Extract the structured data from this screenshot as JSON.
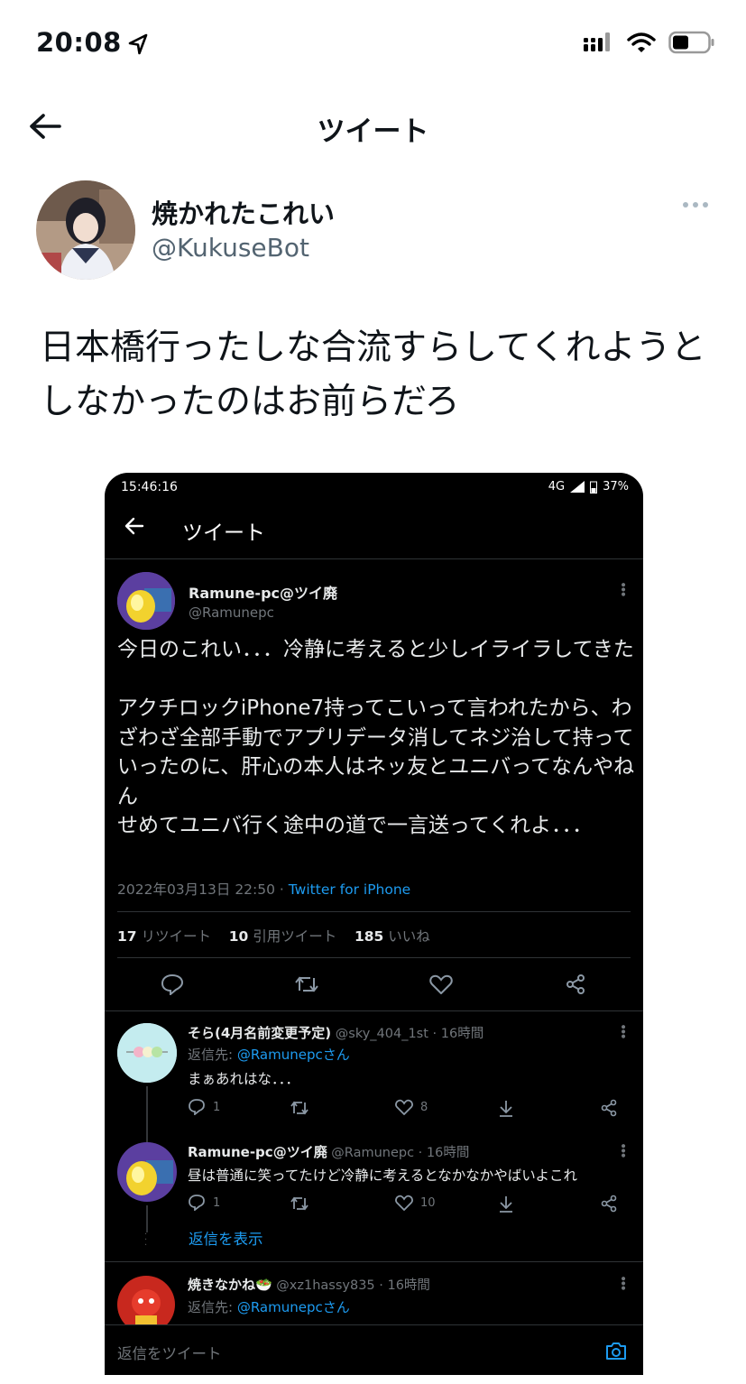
{
  "status_bar": {
    "time": "20:08"
  },
  "header": {
    "title": "ツイート"
  },
  "tweet": {
    "display_name": "焼かれたこれい",
    "handle": "@KukuseBot",
    "text": "日本橋行ったしな合流すらしてくれようとしなかったのはお前らだろ"
  },
  "embedded": {
    "status_time": "15:46:16",
    "status_net": "4G",
    "battery": "37%",
    "header_title": "ツイート",
    "tweet": {
      "display_name": "Ramune-pc@ツイ廃",
      "handle": "@Ramunepc",
      "text": "今日のこれい．．．冷静に考えると少しイライラしてきた\n\nアクチロックiPhone7持ってこいって言われたから、わざわざ全部手動でアプリデータ消してネジ治して持っていったのに、肝心の本人はネッ友とユニバってなんやねん\nせめてユニバ行く途中の道で一言送ってくれよ．．．",
      "date": "2022年03月13日 22:50 · ",
      "source": "Twitter for iPhone",
      "retweets_count": "17",
      "retweets_label": " リツイート",
      "quotes_count": "10",
      "quotes_label": " 引用ツイート",
      "likes_count": "185",
      "likes_label": " いいね"
    },
    "replies": [
      {
        "display_name": "そら(4月名前変更予定)",
        "meta": " @sky_404_1st · 16時間",
        "reply_to_prefix": "返信先: ",
        "reply_to": "@Ramunepcさん",
        "text": "まぁあれはな．．．",
        "reply_count": "1",
        "like_count": "8"
      },
      {
        "display_name": "Ramune-pc@ツイ廃",
        "meta": " @Ramunepc · 16時間",
        "text": "昼は普通に笑ってたけど冷静に考えるとなかなかやばいよこれ",
        "reply_count": "1",
        "like_count": "10"
      },
      {
        "display_name": "焼きなかね🥗",
        "meta": " @xz1hassy835 · 16時間",
        "reply_to_prefix": "返信先: ",
        "reply_to": "@Ramunepcさん"
      }
    ],
    "show_replies": "返信を表示",
    "compose_placeholder": "返信をツイート"
  },
  "colors": {
    "link": "#1d9bf0",
    "muted": "#71767b",
    "dark_bg": "#000000"
  }
}
